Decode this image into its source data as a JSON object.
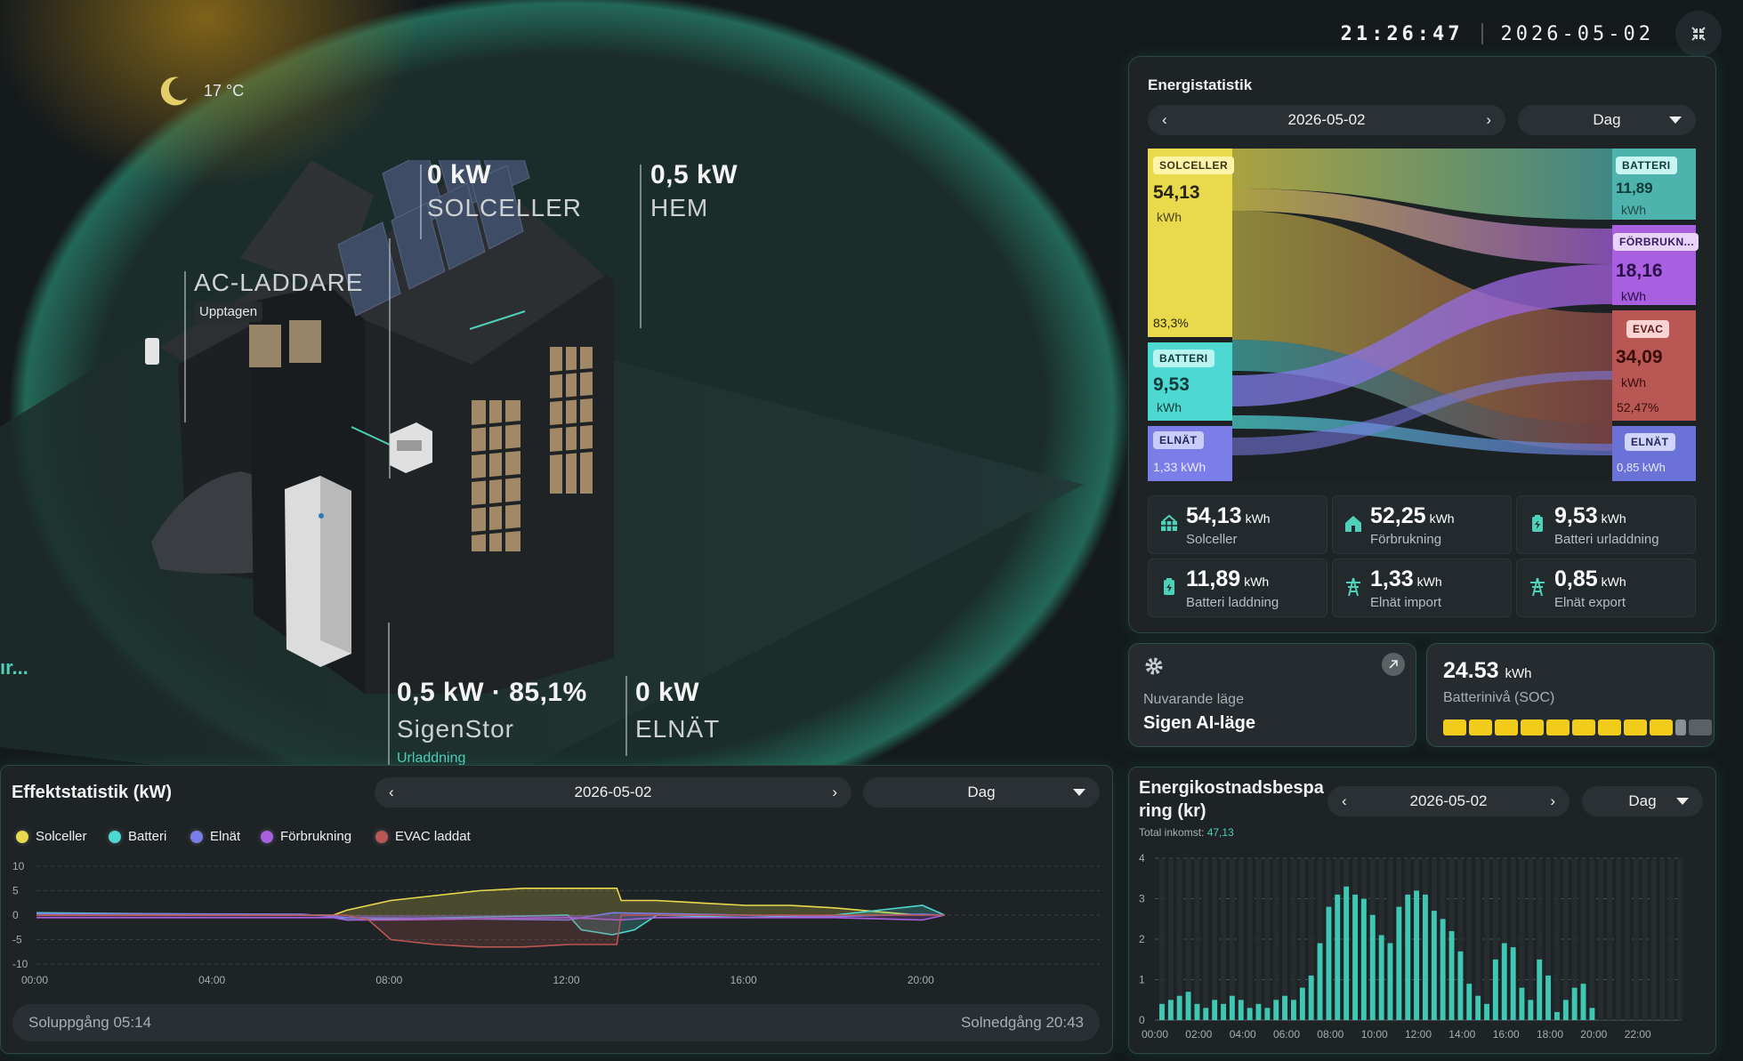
{
  "weather": {
    "icon": "moon-icon",
    "temperature": "17 °C"
  },
  "clock": {
    "time": "21:26:47",
    "date": "2026-05-02"
  },
  "house": {
    "solar": {
      "power": "0 kW",
      "label": "SOLCELLER"
    },
    "home": {
      "power": "0,5 kW",
      "label": "HEM"
    },
    "charger": {
      "label": "AC-LADDARE",
      "status": "Upptagen"
    },
    "battery": {
      "power": "0,5 kW · 85,1%",
      "label": "SigenStor",
      "status": "Urladdning"
    },
    "grid": {
      "power": "0 kW",
      "label": "ELNÄT"
    },
    "cut_text": "ır..."
  },
  "energy_stats": {
    "title": "Energistatistik",
    "date": "2026-05-02",
    "period": "Dag",
    "sankey": {
      "sources": [
        {
          "label": "SOLCELLER",
          "value": "54,13",
          "unit": "kWh",
          "pct": "83,3%",
          "color": "#e8d94d"
        },
        {
          "label": "BATTERI",
          "value": "9,53",
          "unit": "kWh",
          "color": "#4dd9d2"
        },
        {
          "label": "ELNÄT",
          "value": "1,33 kWh",
          "color": "#7b7ee8"
        }
      ],
      "targets": [
        {
          "label": "BATTERI",
          "value": "11,89",
          "unit": "kWh",
          "color": "#4fb3ad"
        },
        {
          "label": "FÖRBRUKN...",
          "value": "18,16",
          "unit": "kWh",
          "color": "#a85fe0"
        },
        {
          "label": "EVAC",
          "value": "34,09",
          "unit": "kWh",
          "pct": "52,47%",
          "color": "#b95754"
        },
        {
          "label": "ELNÄT",
          "value": "0,85 kWh",
          "color": "#6a72d8"
        }
      ]
    },
    "tiles": [
      {
        "icon": "solar-panel-icon",
        "value": "54,13",
        "unit": "kWh",
        "label": "Solceller"
      },
      {
        "icon": "home-icon",
        "value": "52,25",
        "unit": "kWh",
        "label": "Förbrukning"
      },
      {
        "icon": "battery-discharge-icon",
        "value": "9,53",
        "unit": "kWh",
        "label": "Batteri urladdning"
      },
      {
        "icon": "battery-charge-icon",
        "value": "11,89",
        "unit": "kWh",
        "label": "Batteri laddning"
      },
      {
        "icon": "grid-tower-icon",
        "value": "1,33",
        "unit": "kWh",
        "label": "Elnät import"
      },
      {
        "icon": "grid-tower-icon",
        "value": "0,85",
        "unit": "kWh",
        "label": "Elnät export"
      }
    ]
  },
  "mode": {
    "icon": "gear-icon",
    "label": "Nuvarande läge",
    "value": "Sigen AI-läge"
  },
  "soc": {
    "value": "24.53",
    "unit": "kWh",
    "label": "Batterinivå (SOC)",
    "segments_filled": 9,
    "segments_partial": 1,
    "segments_total": 11
  },
  "power_chart": {
    "title": "Effektstatistik (kW)",
    "date": "2026-05-02",
    "period": "Dag",
    "legend": [
      {
        "name": "Solceller",
        "color": "#e8d94d"
      },
      {
        "name": "Batteri",
        "color": "#4dd9d2"
      },
      {
        "name": "Elnät",
        "color": "#7b7ee8"
      },
      {
        "name": "Förbrukning",
        "color": "#a85fe0"
      },
      {
        "name": "EVAC laddat",
        "color": "#b95754"
      }
    ],
    "sunrise": "Soluppgång 05:14",
    "sunset": "Solnedgång 20:43"
  },
  "savings": {
    "title": "Energikostnadsbesparing (kr)",
    "date": "2026-05-02",
    "period": "Dag",
    "total_label": "Total inkomst:",
    "total_value": "47,13"
  },
  "chart_data": [
    {
      "type": "line",
      "title": "Effektstatistik (kW)",
      "x_ticks": [
        "00:00",
        "04:00",
        "08:00",
        "12:00",
        "16:00",
        "20:00"
      ],
      "y_ticks": [
        "10",
        "5",
        "0",
        "-5",
        "-10"
      ],
      "ylim": [
        -10,
        10
      ],
      "xlim": [
        0,
        24
      ],
      "x_unit": "hours",
      "series": [
        {
          "name": "Solceller",
          "x": [
            0,
            6.7,
            7,
            8,
            9,
            10,
            11,
            12,
            13.1,
            13.2,
            14,
            15,
            16,
            17,
            18,
            19.5,
            20
          ],
          "y": [
            0,
            0,
            1,
            3,
            4,
            5,
            5.5,
            5.5,
            5.5,
            3,
            3,
            2.5,
            2,
            2,
            1.5,
            0.3,
            0
          ]
        },
        {
          "name": "Batteri",
          "x": [
            0,
            6.7,
            7,
            12,
            12.3,
            13,
            13.5,
            14,
            16,
            18,
            19,
            20,
            20.5
          ],
          "y": [
            0.5,
            0,
            -1,
            0,
            -3,
            -4,
            -3,
            0,
            -0.5,
            0,
            1,
            2,
            0
          ]
        },
        {
          "name": "Elnät",
          "x": [
            0,
            6,
            7,
            12,
            13,
            18,
            20,
            20.5
          ],
          "y": [
            0.3,
            0.2,
            -0.5,
            -1,
            0.5,
            -0.3,
            0.2,
            0
          ]
        },
        {
          "name": "Förbrukning",
          "x": [
            0,
            6.7,
            7,
            8,
            12,
            13.2,
            14,
            18,
            20,
            20.5
          ],
          "y": [
            -0.5,
            -0.5,
            -1,
            -1,
            -0.5,
            -1,
            -0.5,
            -0.5,
            -1,
            0
          ]
        },
        {
          "name": "EVAC laddat",
          "x": [
            0,
            7,
            7.5,
            8,
            9,
            10,
            11,
            12,
            13.1,
            13.2,
            14,
            20.5
          ],
          "y": [
            0,
            0,
            -1,
            -5,
            -6,
            -6.5,
            -6.5,
            -6,
            -6,
            0,
            0,
            0
          ]
        }
      ]
    },
    {
      "type": "bar",
      "title": "Energikostnadsbesparing (kr)",
      "x_ticks": [
        "00:00",
        "02:00",
        "04:00",
        "06:00",
        "08:00",
        "10:00",
        "12:00",
        "14:00",
        "16:00",
        "18:00",
        "20:00",
        "22:00"
      ],
      "ylim": [
        0,
        4
      ],
      "y_ticks": [
        "4",
        "3",
        "2",
        "1",
        "0"
      ],
      "values": [
        0.4,
        0.5,
        0.6,
        0.7,
        0.4,
        0.3,
        0.5,
        0.4,
        0.6,
        0.5,
        0.3,
        0.4,
        0.3,
        0.5,
        0.6,
        0.5,
        0.8,
        1.1,
        1.9,
        2.8,
        3.1,
        3.3,
        3.1,
        3.0,
        2.6,
        2.1,
        1.9,
        2.8,
        3.1,
        3.2,
        3.1,
        2.7,
        2.5,
        2.2,
        1.7,
        0.9,
        0.6,
        0.4,
        1.5,
        1.9,
        1.8,
        0.8,
        0.5,
        1.5,
        1.1,
        0.2,
        0.5,
        0.8,
        0.9,
        0.3,
        0,
        0,
        0,
        0,
        0,
        0,
        0,
        0,
        0,
        0
      ]
    }
  ]
}
